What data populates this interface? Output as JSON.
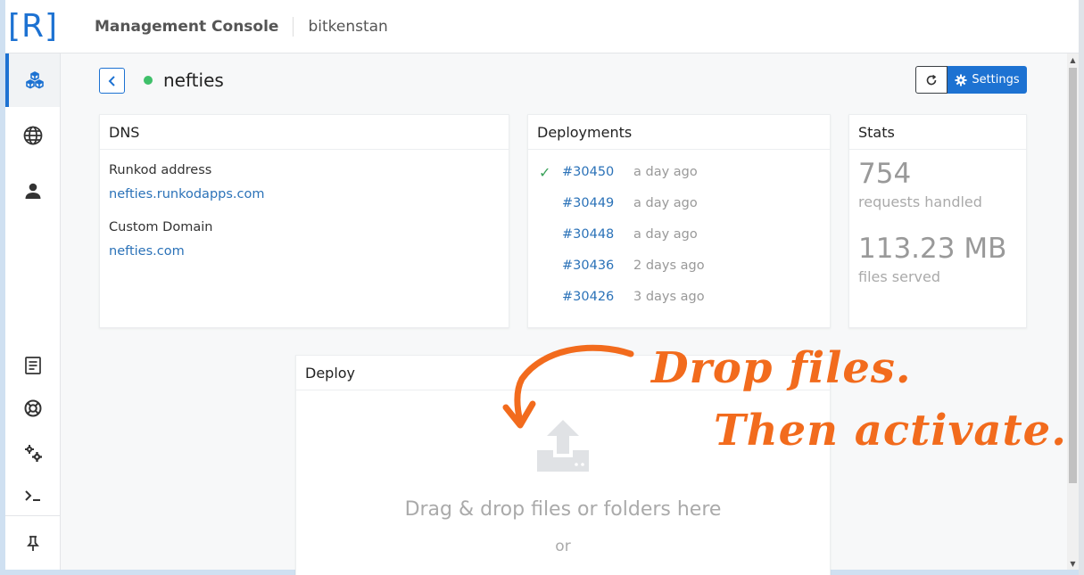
{
  "header": {
    "logo": "[R]",
    "title": "Management Console",
    "org": "bitkenstan"
  },
  "sidebar": {
    "items": [
      {
        "name": "apps",
        "icon": "cubes-icon",
        "active": true
      },
      {
        "name": "domains",
        "icon": "globe-icon"
      },
      {
        "name": "account",
        "icon": "user-icon"
      },
      {
        "name": "docs",
        "icon": "document-icon"
      },
      {
        "name": "support",
        "icon": "lifebuoy-icon"
      },
      {
        "name": "settings",
        "icon": "gears-icon"
      },
      {
        "name": "terminal",
        "icon": "terminal-icon"
      },
      {
        "name": "pin",
        "icon": "pin-icon"
      }
    ]
  },
  "app": {
    "name": "nefties",
    "status_color": "#3fc06a"
  },
  "toolbar": {
    "settings_label": "Settings"
  },
  "dns": {
    "title": "DNS",
    "runkod_label": "Runkod address",
    "runkod_value": "nefties.runkodapps.com",
    "custom_label": "Custom Domain",
    "custom_value": "nefties.com"
  },
  "deployments": {
    "title": "Deployments",
    "items": [
      {
        "id": "#30450",
        "time": "a day ago",
        "active": true
      },
      {
        "id": "#30449",
        "time": "a day ago",
        "active": false
      },
      {
        "id": "#30448",
        "time": "a day ago",
        "active": false
      },
      {
        "id": "#30436",
        "time": "2 days ago",
        "active": false
      },
      {
        "id": "#30426",
        "time": "3 days ago",
        "active": false
      }
    ]
  },
  "stats": {
    "title": "Stats",
    "requests_value": "754",
    "requests_label": "requests handled",
    "files_value": "113.23 MB",
    "files_label": "files served"
  },
  "deploy": {
    "title": "Deploy",
    "drop_text": "Drag & drop files or folders here",
    "or_text": "or"
  },
  "annotation": {
    "line1": "Drop files.",
    "line2": "Then activate."
  },
  "colors": {
    "accent": "#1d72d2",
    "link": "#2b72b8",
    "annotation": "#f26b1d",
    "success": "#3aa15a"
  }
}
